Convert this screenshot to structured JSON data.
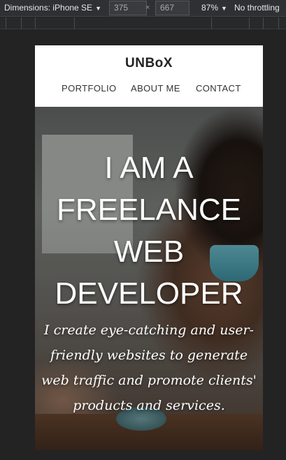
{
  "devtools": {
    "dimensions_label": "Dimensions: iPhone SE",
    "width": "375",
    "height": "667",
    "separator": "×",
    "zoom": "87%",
    "throttling": "No throttling"
  },
  "site": {
    "logo": "UNBoX",
    "nav": [
      {
        "label": "PORTFOLIO"
      },
      {
        "label": "ABOUT ME"
      },
      {
        "label": "CONTACT"
      }
    ]
  },
  "hero": {
    "title_lines": [
      "I AM A",
      "FREELANCE",
      "WEB",
      "DEVELOPER"
    ],
    "subtitle": "I create eye-catching and user-friendly websites to generate web traffic and promote clients' products and services."
  },
  "colors": {
    "devtools_bg": "#2f3033",
    "page_bg": "#232323",
    "header_bg": "#ffffff",
    "accent_cup": "#4f9aa8"
  }
}
